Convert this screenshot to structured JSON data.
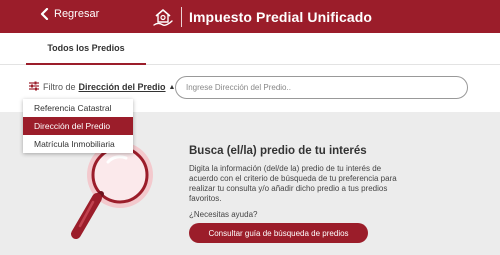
{
  "header": {
    "back_label": "Regresar",
    "title": "Impuesto Predial Unificado",
    "logo_icon": "house-hand-icon",
    "background": "#9b1d2a"
  },
  "tabs": [
    {
      "label": "Todos los Predios",
      "active": true
    }
  ],
  "filter": {
    "prefix": "Filtro de",
    "selected": "Dirección del Predio",
    "icon": "sliders-icon",
    "caret_icon": "caret-up-icon",
    "search_placeholder": "Ingrese Dirección del Predio..",
    "search_value": "",
    "options": [
      {
        "label": "Referencia Catastral",
        "active": false
      },
      {
        "label": "Dirección del Predio",
        "active": true
      },
      {
        "label": "Matrícula Inmobiliaria",
        "active": false
      }
    ]
  },
  "empty_state": {
    "illustration_icon": "magnifying-glass-icon",
    "title": "Busca (el/la) predio de tu interés",
    "description": "Digita la información (del/de la) predio de tu interés de acuerdo con el criterio de búsqueda de tu preferencia para realizar tu consulta y/o añadir dicho predio a tus predios favoritos.",
    "help": "¿Necesitas ayuda?",
    "cta_label": "Consultar guía de búsqueda de predios"
  },
  "accent_color": "#9b1d2a"
}
